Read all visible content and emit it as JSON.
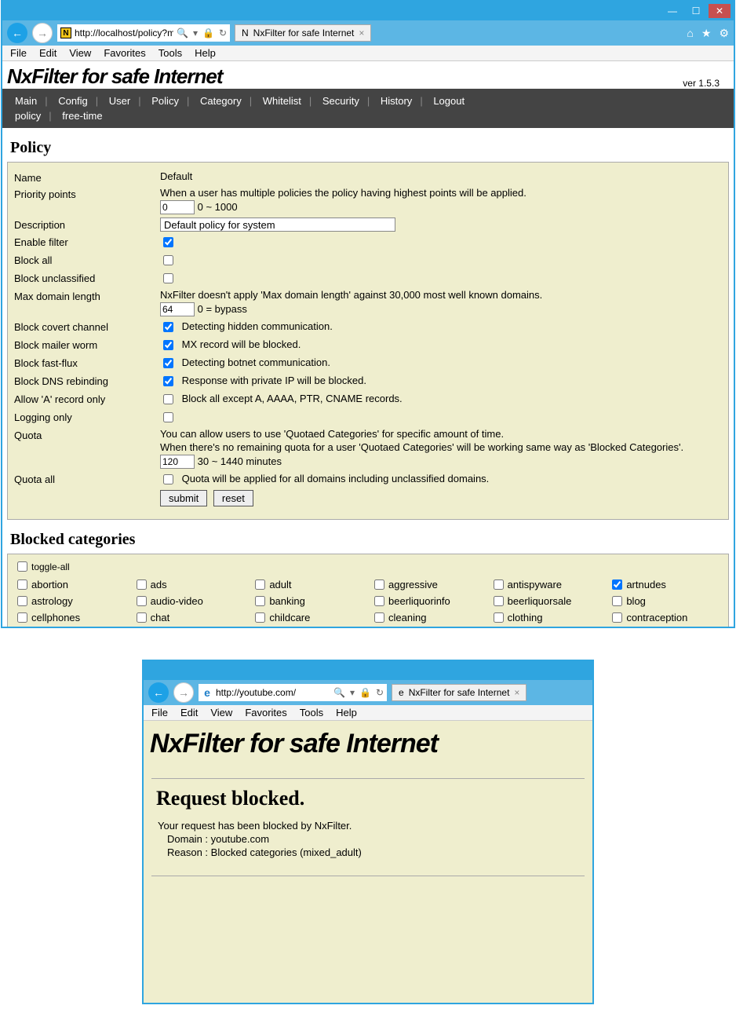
{
  "win1": {
    "titlebar": {
      "min": "—",
      "max": "☐",
      "close": "✕"
    },
    "addrbar": {
      "url": "http://localhost/policy?mod",
      "tab_title": "NxFilter for safe Internet",
      "right_icons": {
        "home": "⌂",
        "star": "★",
        "gear": "⚙"
      },
      "search_glyph": "🔍",
      "dropdown_glyph": "▾",
      "refresh_glyph": "↻",
      "lock_glyph": "🔒",
      "back_glyph": "←",
      "fwd_glyph": "→",
      "favicon_letter": "N"
    },
    "menubar": [
      "File",
      "Edit",
      "View",
      "Favorites",
      "Tools",
      "Help"
    ],
    "app_title": "NxFilter for safe Internet",
    "version": "ver 1.5.3",
    "nav": {
      "row1": [
        "Main",
        "Config",
        "User",
        "Policy",
        "Category",
        "Whitelist",
        "Security",
        "History",
        "Logout"
      ],
      "row2": [
        "policy",
        "free-time"
      ]
    },
    "section_policy": "Policy",
    "form": {
      "labels": {
        "name": "Name",
        "priority": "Priority points",
        "description": "Description",
        "enable_filter": "Enable filter",
        "block_all": "Block all",
        "block_unclassified": "Block unclassified",
        "max_domain": "Max domain length",
        "block_covert": "Block covert channel",
        "block_mailer": "Block mailer worm",
        "block_fastflux": "Block fast-flux",
        "block_dns_rebind": "Block DNS rebinding",
        "allow_a_only": "Allow 'A' record only",
        "logging_only": "Logging only",
        "quota": "Quota",
        "quota_all": "Quota all"
      },
      "values": {
        "name": "Default",
        "priority_hint": "When a user has multiple policies the policy having highest points will be applied.",
        "priority_value": "0",
        "priority_range": "0 ~ 1000",
        "description_value": "Default policy for system",
        "enable_filter_checked": true,
        "block_all_checked": false,
        "block_unclassified_checked": false,
        "max_domain_hint": "NxFilter doesn't apply 'Max domain length' against 30,000 most well known domains.",
        "max_domain_value": "64",
        "max_domain_range": "0 = bypass",
        "block_covert_checked": true,
        "block_covert_text": "Detecting hidden communication.",
        "block_mailer_checked": true,
        "block_mailer_text": "MX record will be blocked.",
        "block_fastflux_checked": true,
        "block_fastflux_text": "Detecting botnet communication.",
        "block_dns_rebind_checked": true,
        "block_dns_rebind_text": "Response with private IP will be blocked.",
        "allow_a_only_checked": false,
        "allow_a_only_text": "Block all except A, AAAA, PTR, CNAME records.",
        "logging_only_checked": false,
        "quota_hint1": "You can allow users to use 'Quotaed Categories' for specific amount of time.",
        "quota_hint2": "When there's no remaining quota for a user 'Quotaed Categories' will be working same way as 'Blocked Categories'.",
        "quota_value": "120",
        "quota_range": "30 ~ 1440 minutes",
        "quota_all_checked": false,
        "quota_all_text": "Quota will be applied for all domains including unclassified domains.",
        "submit_label": "submit",
        "reset_label": "reset"
      }
    },
    "section_categories": "Blocked categories",
    "toggle_all_label": "toggle-all",
    "categories": [
      {
        "name": "abortion",
        "checked": false
      },
      {
        "name": "ads",
        "checked": false
      },
      {
        "name": "adult",
        "checked": false
      },
      {
        "name": "aggressive",
        "checked": false
      },
      {
        "name": "antispyware",
        "checked": false
      },
      {
        "name": "artnudes",
        "checked": true
      },
      {
        "name": "astrology",
        "checked": false
      },
      {
        "name": "audio-video",
        "checked": false
      },
      {
        "name": "banking",
        "checked": false
      },
      {
        "name": "beerliquorinfo",
        "checked": false
      },
      {
        "name": "beerliquorsale",
        "checked": false
      },
      {
        "name": "blog",
        "checked": false
      },
      {
        "name": "cellphones",
        "checked": false
      },
      {
        "name": "chat",
        "checked": false
      },
      {
        "name": "childcare",
        "checked": false
      },
      {
        "name": "cleaning",
        "checked": false
      },
      {
        "name": "clothing",
        "checked": false
      },
      {
        "name": "contraception",
        "checked": false
      }
    ]
  },
  "win2": {
    "addrbar": {
      "url": "http://youtube.com/",
      "tab_title": "NxFilter for safe Internet",
      "back_glyph": "←",
      "fwd_glyph": "→",
      "search_glyph": "🔍",
      "dropdown_glyph": "▾",
      "refresh_glyph": "↻",
      "lock_glyph": "🔒",
      "favicon_letter": "e"
    },
    "menubar": [
      "File",
      "Edit",
      "View",
      "Favorites",
      "Tools",
      "Help"
    ],
    "app_title": "NxFilter for safe Internet",
    "blocked_head": "Request blocked.",
    "blocked_msg": "Your request has been blocked by NxFilter.",
    "blocked_domain": "Domain : youtube.com",
    "blocked_reason": "Reason : Blocked categories (mixed_adult)"
  }
}
